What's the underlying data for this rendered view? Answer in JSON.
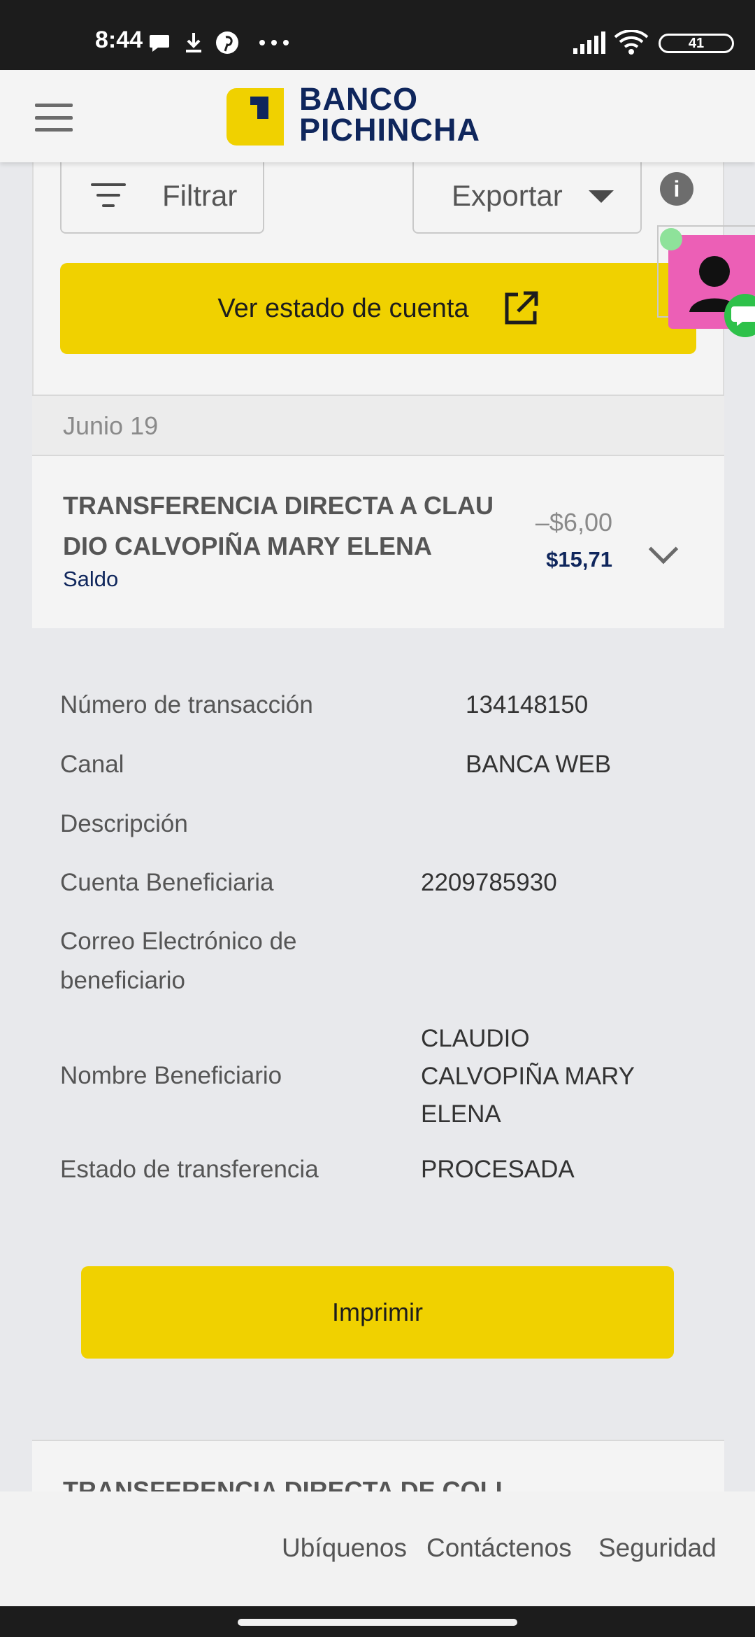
{
  "status_bar": {
    "time": "8:44",
    "battery": "41",
    "icons": [
      "chat-bubble-icon",
      "download-icon",
      "pinterest-icon",
      "more-dots-icon",
      "signal-icon",
      "wifi-icon",
      "battery-icon"
    ]
  },
  "header": {
    "logo_line1": "BANCO",
    "logo_line2": "PICHINCHA",
    "brand_yellow": "#f0d100",
    "brand_navy": "#0f265c"
  },
  "toolbar": {
    "filter_label": "Filtrar",
    "export_label": "Exportar",
    "info_icon": "i"
  },
  "statement_button": {
    "label": "Ver estado de cuenta"
  },
  "date_group": {
    "label": "Junio 19"
  },
  "transaction": {
    "title": "TRANSFERENCIA DIRECTA A CLAUDIO CALVOPIÑA MARY ELENA",
    "subtitle": "Saldo",
    "amount": "–$6,00",
    "balance": "$15,71"
  },
  "details": {
    "transaction_number_label": "Número de transacción",
    "transaction_number_value": "134148150",
    "channel_label": "Canal",
    "channel_value": "BANCA WEB",
    "description_label": "Descripción",
    "beneficiary_account_label": "Cuenta Beneficiaria",
    "beneficiary_account_value": "2209785930",
    "beneficiary_email_label": "Correo Electrónico de beneficiario",
    "beneficiary_name_label": "Nombre Beneficiario",
    "beneficiary_name_value": "CLAUDIO CALVOPIÑA MARY ELENA",
    "transfer_status_label": "Estado de transferencia",
    "transfer_status_value": "PROCESADA",
    "print_label": "Imprimir"
  },
  "next_transaction": {
    "title": "TRANSFERENCIA DIRECTA DE COLL"
  },
  "footer": {
    "link1": "Ubíquenos",
    "link2": "Contáctenos",
    "link3": "Seguridad"
  }
}
